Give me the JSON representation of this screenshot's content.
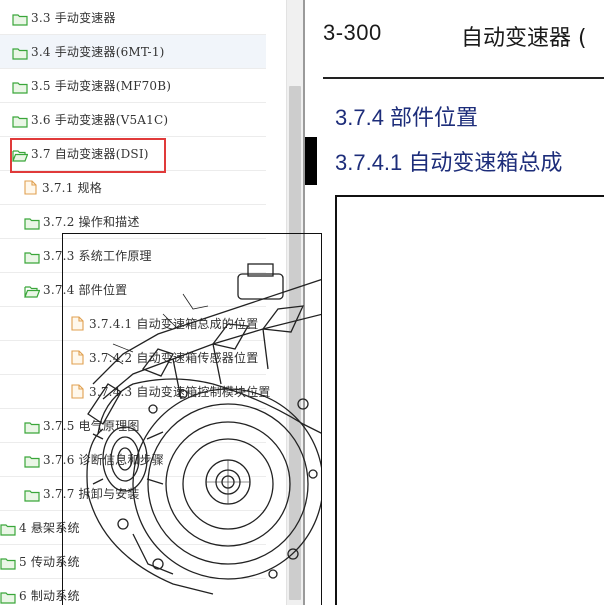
{
  "tree": {
    "items": [
      {
        "label": "3.3 手动变速器",
        "icon": "folder-closed-icon",
        "indent": 0
      },
      {
        "label": "3.4 手动变速器(6MT-1)",
        "icon": "folder-closed-icon",
        "indent": 0
      },
      {
        "label": "3.5 手动变速器(MF70B)",
        "icon": "folder-closed-icon",
        "indent": 0
      },
      {
        "label": "3.6 手动变速器(V5A1C)",
        "icon": "folder-closed-icon",
        "indent": 0
      },
      {
        "label": "3.7 自动变速器(DSI)",
        "icon": "folder-open-icon",
        "indent": 0
      },
      {
        "label": "3.7.1 规格",
        "icon": "document-icon",
        "indent": 1
      },
      {
        "label": "3.7.2 操作和描述",
        "icon": "folder-closed-icon",
        "indent": 1
      },
      {
        "label": "3.7.3 系统工作原理",
        "icon": "folder-closed-icon",
        "indent": 1
      },
      {
        "label": "3.7.4 部件位置",
        "icon": "folder-open-icon",
        "indent": 1
      },
      {
        "label": "3.7.4.1 自动变速箱总成的位置",
        "icon": "document-icon",
        "indent": 2
      },
      {
        "label": "3.7.4.2 自动变速箱传感器位置",
        "icon": "document-icon",
        "indent": 2
      },
      {
        "label": "3.7.4.3 自动变速箱控制模块位置",
        "icon": "document-icon",
        "indent": 2
      },
      {
        "label": "3.7.5 电气原理图",
        "icon": "folder-closed-icon",
        "indent": 1
      },
      {
        "label": "3.7.6 诊断信息和步骤",
        "icon": "folder-closed-icon",
        "indent": 1
      },
      {
        "label": "3.7.7 拆卸与安装",
        "icon": "folder-closed-icon",
        "indent": 1
      },
      {
        "label": "4 悬架系统",
        "icon": "folder-closed-icon",
        "indent": -1
      },
      {
        "label": "5 传动系统",
        "icon": "folder-closed-icon",
        "indent": -1
      },
      {
        "label": "6 制动系统",
        "icon": "folder-closed-icon",
        "indent": -1
      }
    ],
    "selected_index": 1,
    "highlighted_index": 4
  },
  "doc": {
    "page_number": "3-300",
    "title": "自动变速器 (",
    "section": "3.7.4 部件位置",
    "subsection": "3.7.4.1  自动变速箱总成"
  },
  "colors": {
    "folder": "#3aa63a",
    "document": "#e0a050",
    "heading": "#1d2d7a",
    "highlight_box": "#e03a3a"
  }
}
